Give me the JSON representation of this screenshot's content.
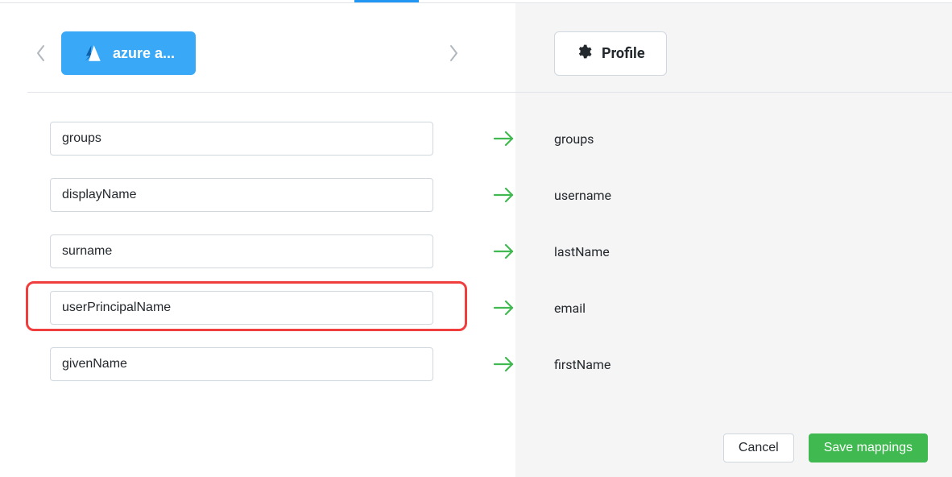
{
  "source": {
    "provider_label": "azure a..."
  },
  "target": {
    "section_label": "Profile"
  },
  "mappings": [
    {
      "source": "groups",
      "target": "groups",
      "highlight": false
    },
    {
      "source": "displayName",
      "target": "username",
      "highlight": false
    },
    {
      "source": "surname",
      "target": "lastName",
      "highlight": false
    },
    {
      "source": "userPrincipalName",
      "target": "email",
      "highlight": true
    },
    {
      "source": "givenName",
      "target": "firstName",
      "highlight": false
    }
  ],
  "buttons": {
    "cancel": "Cancel",
    "save": "Save mappings"
  }
}
